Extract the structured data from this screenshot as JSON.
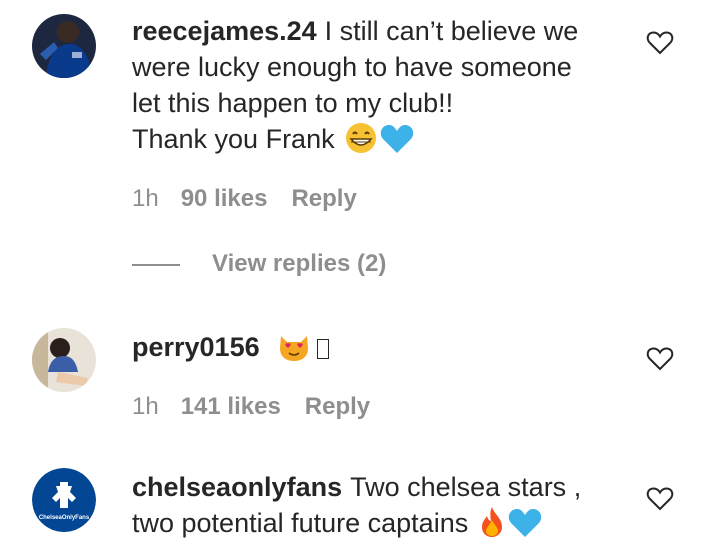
{
  "comments": [
    {
      "username": "reecejames.24",
      "text_line1": "I still can’t believe we",
      "text_line2": "were lucky enough to have someone",
      "text_line3": "let this happen to my club!!",
      "text_line4": "Thank you Frank",
      "emojis": [
        "grinning-face-emoji",
        "blue-heart-emoji"
      ],
      "time": "1h",
      "likes": "90 likes",
      "reply": "Reply",
      "view_replies": "View replies (2)"
    },
    {
      "username": "perry0156",
      "emojis": [
        "heart-eyes-cat-emoji",
        "missing-glyph"
      ],
      "time": "1h",
      "likes": "141 likes",
      "reply": "Reply"
    },
    {
      "username": "chelseaonlyfans",
      "text_line1": "Two chelsea stars ,",
      "text_line2": "two potential future captains",
      "emojis": [
        "fire-emoji",
        "blue-heart-emoji"
      ],
      "avatar_text": "ChelseaOnlyFans"
    }
  ],
  "colors": {
    "text": "#262626",
    "secondary": "#8e8e8e",
    "chelsea_blue": "#034694",
    "emoji_blue": "#3db2e8"
  }
}
